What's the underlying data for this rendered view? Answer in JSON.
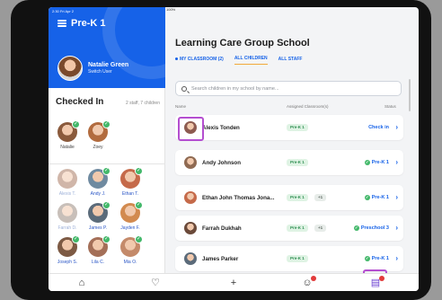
{
  "status_bar": {
    "time_date": "2:30 Fri Apr 2",
    "battery": "100%"
  },
  "sidebar": {
    "class_title": "Pre-K 1",
    "user_name": "Natalie Green",
    "switch_user": "Switch User",
    "checked_in_label": "Checked In",
    "checked_in_count": "2 staff, 7 children",
    "staff": [
      {
        "name": "Natalie",
        "color": "#8a5a3c"
      },
      {
        "name": "Zoey",
        "color": "#b26b3e"
      }
    ],
    "children": [
      {
        "name": "Alexis T.",
        "color": "#a97a63",
        "faded": true
      },
      {
        "name": "Andy J.",
        "color": "#6f8aa0",
        "faded": false
      },
      {
        "name": "Ethan T.",
        "color": "#c56a4a",
        "faded": false
      },
      {
        "name": "Farrah D.",
        "color": "#9b8b80",
        "faded": true
      },
      {
        "name": "James P.",
        "color": "#5b6b7a",
        "faded": false
      },
      {
        "name": "Jayden F.",
        "color": "#d28a4f",
        "faded": false
      },
      {
        "name": "Joseph S.",
        "color": "#7d5a44",
        "faded": false
      },
      {
        "name": "Lila C.",
        "color": "#a46f58",
        "faded": false
      },
      {
        "name": "Mia O.",
        "color": "#c48a6a",
        "faded": false
      }
    ]
  },
  "main": {
    "school_name": "Learning Care Group School",
    "tabs": [
      {
        "label": "MY CLASSROOM (2)"
      },
      {
        "label": "ALL CHILDREN"
      },
      {
        "label": "ALL STAFF"
      }
    ],
    "search_placeholder": "Search children in my school by name...",
    "columns": {
      "name": "Name",
      "classroom": "Assigned Classroom(s)",
      "status": "Status"
    },
    "rows": [
      {
        "name": "Alexis Tonden",
        "classroom": "Pre-K 1",
        "extra": "",
        "status": "Check in",
        "checked": false,
        "color": "#8d5a50"
      },
      {
        "name": "Andy Johnson",
        "classroom": "Pre-K 1",
        "extra": "",
        "status": "Pre-K 1",
        "checked": true,
        "color": "#8f6a52"
      },
      {
        "name": "Ethan John Thomas Jona...",
        "classroom": "Pre-K 1",
        "extra": "+1",
        "status": "Pre-K 1",
        "checked": true,
        "color": "#c56a4a"
      },
      {
        "name": "Farrah Dukhah",
        "classroom": "Pre-K 1",
        "extra": "+1",
        "status": "Preschool 3",
        "checked": true,
        "color": "#6b4a3a"
      },
      {
        "name": "James Parker",
        "classroom": "Pre-K 1",
        "extra": "",
        "status": "Pre-K 1",
        "checked": true,
        "color": "#5b6b7a"
      }
    ]
  },
  "bottom_nav": {
    "items": [
      {
        "name": "home-icon",
        "glyph": "⌂"
      },
      {
        "name": "heart-icon",
        "glyph": "♡"
      },
      {
        "name": "plus-icon",
        "glyph": "+"
      },
      {
        "name": "messages-icon",
        "glyph": "☺"
      },
      {
        "name": "roster-icon",
        "glyph": "▤"
      }
    ]
  },
  "colors": {
    "accent": "#1662e8",
    "highlight": "#b44ed0",
    "success": "#43b86a"
  }
}
